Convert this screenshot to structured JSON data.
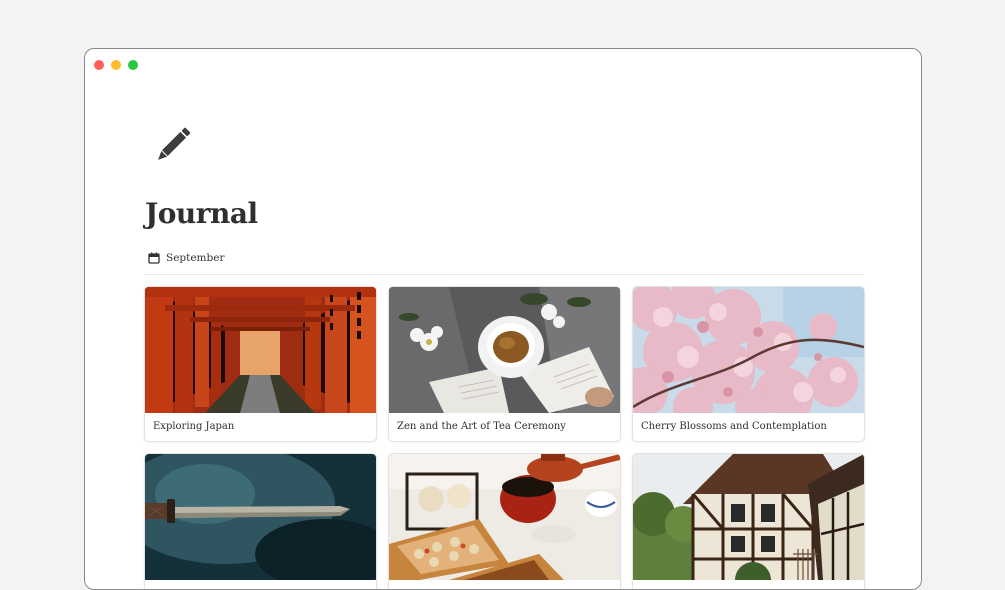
{
  "window": {
    "controls": [
      "close",
      "minimize",
      "zoom"
    ]
  },
  "page": {
    "icon": "pencil-icon",
    "title": "Journal"
  },
  "view": {
    "icon": "calendar-icon",
    "label": "September"
  },
  "cards": [
    {
      "title": "Exploring Japan",
      "cover": "torii-gates-photo"
    },
    {
      "title": "Zen and the Art of Tea Ceremony",
      "cover": "tea-cup-photo"
    },
    {
      "title": "Cherry Blossoms and Contemplation",
      "cover": "cherry-blossom-photo"
    },
    {
      "title": "",
      "cover": "katana-photo"
    },
    {
      "title": "",
      "cover": "bento-teapot-photo"
    },
    {
      "title": "",
      "cover": "timber-house-photo"
    }
  ],
  "colors": {
    "background": "#f3f3f5",
    "window": "#ffffff",
    "title_text": "#2f2f2f",
    "close": "#ff5f57",
    "minimize": "#febc2e",
    "zoom": "#28c840"
  }
}
